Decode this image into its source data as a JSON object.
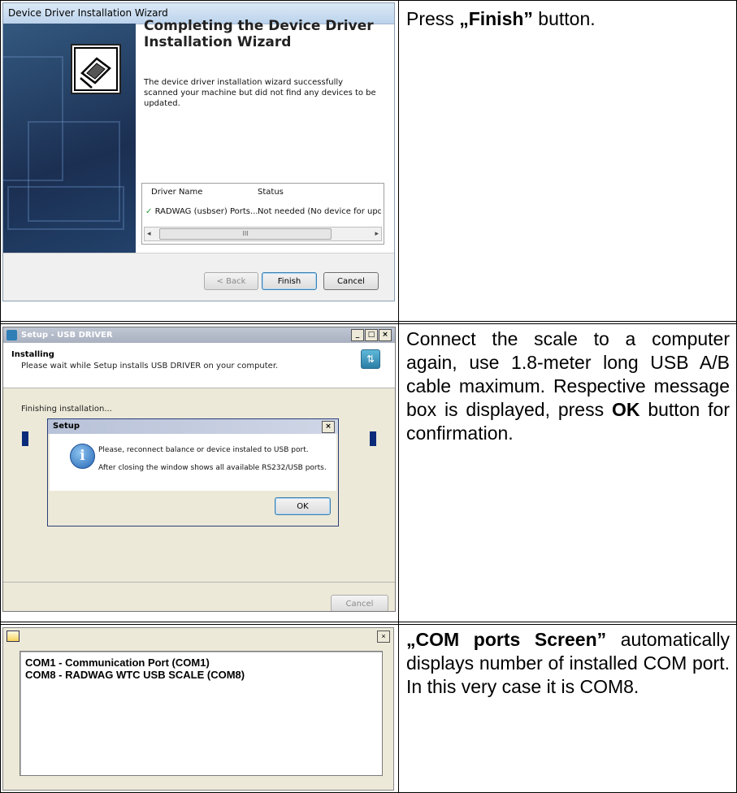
{
  "rows": [
    {
      "description_parts": [
        {
          "text": "Press ",
          "bold": false
        },
        {
          "text": "„Finish”",
          "bold": true
        },
        {
          "text": " button.",
          "bold": false
        }
      ]
    },
    {
      "description_parts": [
        {
          "text": "Connect the scale to a computer again, use 1.8-meter long USB A/B cable maximum. Respective message box is displayed, press ",
          "bold": false
        },
        {
          "text": "OK",
          "bold": true
        },
        {
          "text": " button for confirmation.",
          "bold": false
        }
      ]
    },
    {
      "description_parts": [
        {
          "text": "„COM ports Screen”",
          "bold": true
        },
        {
          "text": " automatically displays number of installed COM port. In this very case it is COM8.",
          "bold": false
        }
      ]
    }
  ],
  "wizard": {
    "window_title": "Device Driver Installation Wizard",
    "heading": "Completing the Device Driver Installation Wizard",
    "body_text": "The device driver installation wizard successfully scanned your machine but did not find any devices to be updated.",
    "table": {
      "columns": [
        "Driver Name",
        "Status"
      ],
      "row": {
        "driver": "RADWAG (usbser) Ports...",
        "status": "Not needed (No device for updat"
      }
    },
    "scroll_thumb_glyph": "III",
    "back_label": "< Back",
    "finish_label": "Finish",
    "cancel_label": "Cancel"
  },
  "setup": {
    "window_title": "Setup - USB DRIVER",
    "min_glyph": "_",
    "max_glyph": "□",
    "close_glyph": "×",
    "heading": "Installing",
    "subheading": "Please wait while Setup installs USB DRIVER on your computer.",
    "status_text": "Finishing installation...",
    "cancel_label": "Cancel",
    "dialog": {
      "title": "Setup",
      "line1": "Please, reconnect balance or device instaled to USB port.",
      "line2": "After closing the window shows all available RS232/USB ports.",
      "ok_label": "OK"
    }
  },
  "com_ports": {
    "close_glyph": "×",
    "items": [
      "COM1 - Communication Port (COM1)",
      "COM8 - RADWAG WTC USB SCALE (COM8)"
    ]
  },
  "colors": {
    "check": "#2e9b34",
    "progress": "#0a2a7a",
    "info_icon": "#2666b6"
  }
}
